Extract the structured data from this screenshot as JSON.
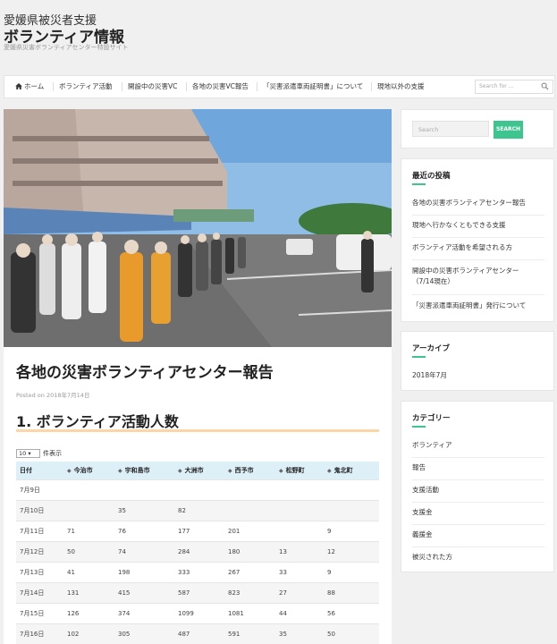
{
  "header": {
    "pre_title": "愛媛県被災者支援",
    "title": "ボランティア情報",
    "description": "愛媛県災害ボランティアセンター特設サイト"
  },
  "nav": {
    "items": [
      {
        "label": "ホーム",
        "icon": "home-icon"
      },
      {
        "label": "ボランティア活動"
      },
      {
        "label": "開設中の災害VC"
      },
      {
        "label": "各地の災害VC報告"
      },
      {
        "label": "「災害派遣車両証明書」について"
      },
      {
        "label": "現地以外の支援"
      }
    ],
    "search_placeholder": "Search for ..."
  },
  "post": {
    "title": "各地の災害ボランティアセンター報告",
    "meta": "Posted on 2018年7月14日",
    "section_title": "1. ボランティア活動人数",
    "entries_value": "10",
    "entries_label": "件表示",
    "table": {
      "headers": [
        "日付",
        "今治市",
        "宇和島市",
        "大洲市",
        "西予市",
        "松野町",
        "鬼北町"
      ],
      "rows": [
        [
          "7月9日",
          "",
          "",
          "",
          "",
          "",
          ""
        ],
        [
          "7月10日",
          "",
          "35",
          "82",
          "",
          "",
          ""
        ],
        [
          "7月11日",
          "71",
          "76",
          "177",
          "201",
          "",
          "9"
        ],
        [
          "7月12日",
          "50",
          "74",
          "284",
          "180",
          "13",
          "12"
        ],
        [
          "7月13日",
          "41",
          "198",
          "333",
          "267",
          "33",
          "9"
        ],
        [
          "7月14日",
          "131",
          "415",
          "587",
          "823",
          "27",
          "88"
        ],
        [
          "7月15日",
          "126",
          "374",
          "1099",
          "1081",
          "44",
          "56"
        ],
        [
          "7月16日",
          "102",
          "305",
          "487",
          "591",
          "35",
          "50"
        ]
      ]
    }
  },
  "sidebar": {
    "search_placeholder": "Search",
    "search_button": "SEARCH",
    "recent": {
      "title": "最近の投稿",
      "items": [
        [
          "各地の災害ボランティアセンター報告"
        ],
        [
          "現地へ行かなくともできる支援"
        ],
        [
          "ボランティア活動を希望される方"
        ],
        [
          "開設中の災害ボランティアセンター",
          "（7/14現在）"
        ],
        [
          "「災害派遣車両証明書」発行について"
        ]
      ]
    },
    "archive": {
      "title": "アーカイブ",
      "items": [
        "2018年7月"
      ]
    },
    "categories": {
      "title": "カテゴリー",
      "items": [
        "ボランティア",
        "報告",
        "支援活動",
        "支援金",
        "義援金",
        "被災された方"
      ]
    }
  },
  "colors": {
    "accent": "#3ec58f",
    "underline": "#fbd6a6",
    "table_header": "#ddf0f8"
  }
}
